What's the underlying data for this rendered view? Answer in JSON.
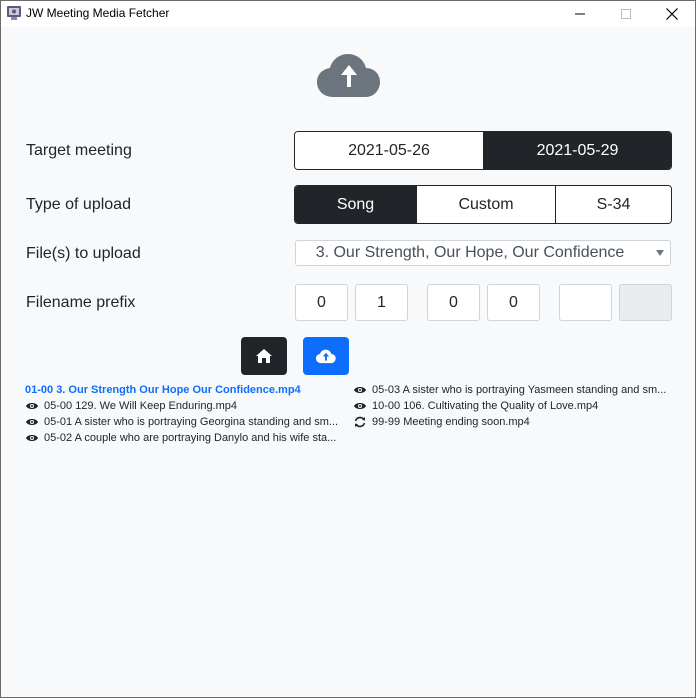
{
  "window": {
    "title": "JW Meeting Media Fetcher",
    "controls": [
      "minimize",
      "maximize",
      "close"
    ]
  },
  "header": {
    "icon": "cloud-upload-icon"
  },
  "form": {
    "target_meeting": {
      "label": "Target meeting",
      "options": [
        "2021-05-26",
        "2021-05-29"
      ],
      "selected": "2021-05-29"
    },
    "upload_type": {
      "label": "Type of upload",
      "options": [
        "Song",
        "Custom",
        "S-34"
      ],
      "selected": "Song"
    },
    "files": {
      "label": "File(s) to upload",
      "value": "3. Our Strength, Our Hope, Our Confidence"
    },
    "prefix": {
      "label": "Filename prefix",
      "digits": [
        "0",
        "1",
        "0",
        "0",
        "",
        ""
      ]
    }
  },
  "buttons": {
    "home": {
      "icon": "home-icon"
    },
    "upload": {
      "icon": "cloud-upload-icon"
    }
  },
  "file_list": {
    "left": [
      {
        "name": "01-00 3. Our Strength Our Hope Our Confidence.mp4",
        "icon": "",
        "highlight": true
      },
      {
        "name": "05-00 129. We Will Keep Enduring.mp4",
        "icon": "eye-icon",
        "highlight": false
      },
      {
        "name": "05-01 A sister who is portraying Georgina standing and sm...",
        "icon": "eye-icon",
        "highlight": false
      },
      {
        "name": "05-02 A couple who are portraying Danylo and his wife sta...",
        "icon": "eye-icon",
        "highlight": false
      }
    ],
    "right": [
      {
        "name": "05-03 A sister who is portraying Yasmeen standing and sm...",
        "icon": "eye-icon",
        "highlight": false
      },
      {
        "name": "10-00 106. Cultivating the Quality of Love.mp4",
        "icon": "eye-icon",
        "highlight": false
      },
      {
        "name": "99-99 Meeting ending soon.mp4",
        "icon": "sync-icon",
        "highlight": false
      }
    ]
  },
  "colors": {
    "dark": "#212529",
    "primary": "#0d6efd",
    "cloud": "#6c757d"
  }
}
